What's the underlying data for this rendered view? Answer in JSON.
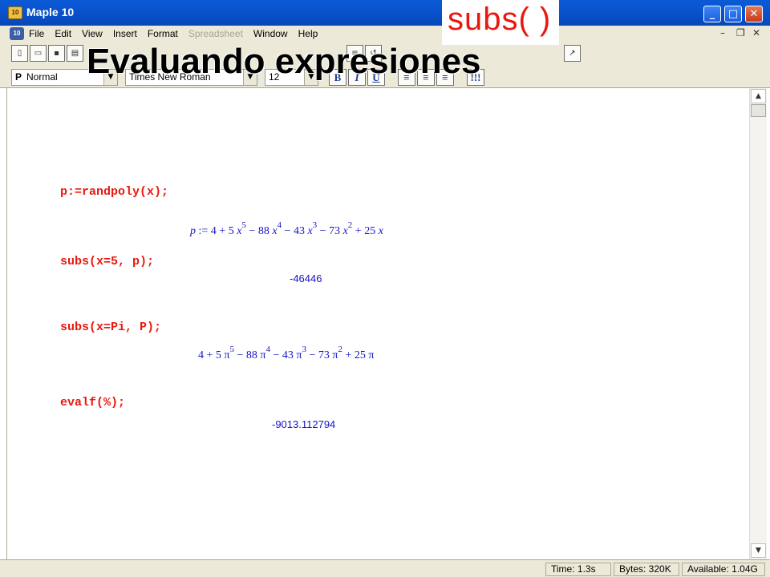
{
  "window": {
    "title": "Maple 10",
    "app_icon": "maple-leaf-icon",
    "controls": {
      "minimize": "_",
      "maximize": "□",
      "close": "✕"
    }
  },
  "menu": {
    "items": [
      {
        "label": "File",
        "enabled": true
      },
      {
        "label": "Edit",
        "enabled": true
      },
      {
        "label": "View",
        "enabled": true
      },
      {
        "label": "Insert",
        "enabled": true
      },
      {
        "label": "Format",
        "enabled": true
      },
      {
        "label": "Spreadsheet",
        "enabled": false
      },
      {
        "label": "Window",
        "enabled": true
      },
      {
        "label": "Help",
        "enabled": true
      }
    ],
    "doc_controls": {
      "minimize": "–",
      "restore": "❐",
      "close": "✕"
    }
  },
  "toolbar": {
    "style_prefix": "P",
    "style": "Normal",
    "font": "Times New Roman",
    "size": "12",
    "bold": "B",
    "italic": "I",
    "underline": "U"
  },
  "overlay": {
    "command": "subs( )",
    "heading": "Evaluando expresiones"
  },
  "worksheet": {
    "lines": [
      {
        "input": "p:=randpoly(x);"
      },
      {
        "input": "subs(x=5, p);",
        "output": "-46446"
      },
      {
        "input": "subs(x=Pi, P);"
      },
      {
        "input": "evalf(%);",
        "output": "-9013.112794"
      }
    ],
    "output1": {
      "lhs": "p",
      "assign": ":=",
      "c0": "4",
      "c1": "5",
      "v": "x",
      "e5": "5",
      "op1": "− 88",
      "e4": "4",
      "op2": "− 43",
      "e3": "3",
      "op3": "− 73",
      "e2": "2",
      "op4": "+ 25"
    },
    "output3": {
      "c0": "4",
      "c1": "5",
      "v": "π",
      "e5": "5",
      "op1": "− 88",
      "e4": "4",
      "op2": "− 43",
      "e3": "3",
      "op3": "− 73",
      "e2": "2",
      "op4": "+ 25"
    }
  },
  "status": {
    "time": "Time:  1.3s",
    "bytes": "Bytes:  320K",
    "available": "Available:  1.04G"
  },
  "colors": {
    "input": "#e8180e",
    "output": "#1414c8",
    "titlebar": "#0a53cf",
    "chrome": "#ece9d8"
  }
}
